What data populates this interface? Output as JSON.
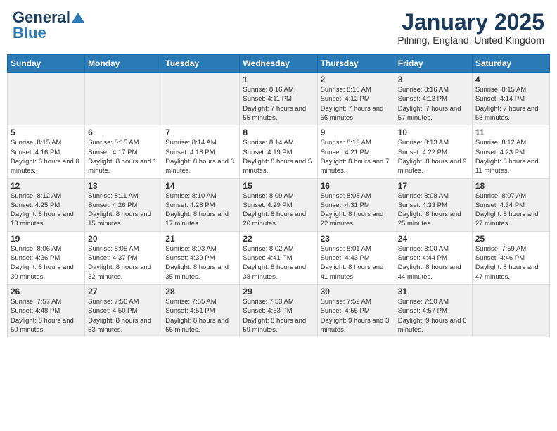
{
  "header": {
    "logo_line1": "General",
    "logo_line2": "Blue",
    "month": "January 2025",
    "location": "Pilning, England, United Kingdom"
  },
  "weekdays": [
    "Sunday",
    "Monday",
    "Tuesday",
    "Wednesday",
    "Thursday",
    "Friday",
    "Saturday"
  ],
  "weeks": [
    [
      {
        "day": "",
        "info": ""
      },
      {
        "day": "",
        "info": ""
      },
      {
        "day": "",
        "info": ""
      },
      {
        "day": "1",
        "info": "Sunrise: 8:16 AM\nSunset: 4:11 PM\nDaylight: 7 hours and 55 minutes."
      },
      {
        "day": "2",
        "info": "Sunrise: 8:16 AM\nSunset: 4:12 PM\nDaylight: 7 hours and 56 minutes."
      },
      {
        "day": "3",
        "info": "Sunrise: 8:16 AM\nSunset: 4:13 PM\nDaylight: 7 hours and 57 minutes."
      },
      {
        "day": "4",
        "info": "Sunrise: 8:15 AM\nSunset: 4:14 PM\nDaylight: 7 hours and 58 minutes."
      }
    ],
    [
      {
        "day": "5",
        "info": "Sunrise: 8:15 AM\nSunset: 4:16 PM\nDaylight: 8 hours and 0 minutes."
      },
      {
        "day": "6",
        "info": "Sunrise: 8:15 AM\nSunset: 4:17 PM\nDaylight: 8 hours and 1 minute."
      },
      {
        "day": "7",
        "info": "Sunrise: 8:14 AM\nSunset: 4:18 PM\nDaylight: 8 hours and 3 minutes."
      },
      {
        "day": "8",
        "info": "Sunrise: 8:14 AM\nSunset: 4:19 PM\nDaylight: 8 hours and 5 minutes."
      },
      {
        "day": "9",
        "info": "Sunrise: 8:13 AM\nSunset: 4:21 PM\nDaylight: 8 hours and 7 minutes."
      },
      {
        "day": "10",
        "info": "Sunrise: 8:13 AM\nSunset: 4:22 PM\nDaylight: 8 hours and 9 minutes."
      },
      {
        "day": "11",
        "info": "Sunrise: 8:12 AM\nSunset: 4:23 PM\nDaylight: 8 hours and 11 minutes."
      }
    ],
    [
      {
        "day": "12",
        "info": "Sunrise: 8:12 AM\nSunset: 4:25 PM\nDaylight: 8 hours and 13 minutes."
      },
      {
        "day": "13",
        "info": "Sunrise: 8:11 AM\nSunset: 4:26 PM\nDaylight: 8 hours and 15 minutes."
      },
      {
        "day": "14",
        "info": "Sunrise: 8:10 AM\nSunset: 4:28 PM\nDaylight: 8 hours and 17 minutes."
      },
      {
        "day": "15",
        "info": "Sunrise: 8:09 AM\nSunset: 4:29 PM\nDaylight: 8 hours and 20 minutes."
      },
      {
        "day": "16",
        "info": "Sunrise: 8:08 AM\nSunset: 4:31 PM\nDaylight: 8 hours and 22 minutes."
      },
      {
        "day": "17",
        "info": "Sunrise: 8:08 AM\nSunset: 4:33 PM\nDaylight: 8 hours and 25 minutes."
      },
      {
        "day": "18",
        "info": "Sunrise: 8:07 AM\nSunset: 4:34 PM\nDaylight: 8 hours and 27 minutes."
      }
    ],
    [
      {
        "day": "19",
        "info": "Sunrise: 8:06 AM\nSunset: 4:36 PM\nDaylight: 8 hours and 30 minutes."
      },
      {
        "day": "20",
        "info": "Sunrise: 8:05 AM\nSunset: 4:37 PM\nDaylight: 8 hours and 32 minutes."
      },
      {
        "day": "21",
        "info": "Sunrise: 8:03 AM\nSunset: 4:39 PM\nDaylight: 8 hours and 35 minutes."
      },
      {
        "day": "22",
        "info": "Sunrise: 8:02 AM\nSunset: 4:41 PM\nDaylight: 8 hours and 38 minutes."
      },
      {
        "day": "23",
        "info": "Sunrise: 8:01 AM\nSunset: 4:43 PM\nDaylight: 8 hours and 41 minutes."
      },
      {
        "day": "24",
        "info": "Sunrise: 8:00 AM\nSunset: 4:44 PM\nDaylight: 8 hours and 44 minutes."
      },
      {
        "day": "25",
        "info": "Sunrise: 7:59 AM\nSunset: 4:46 PM\nDaylight: 8 hours and 47 minutes."
      }
    ],
    [
      {
        "day": "26",
        "info": "Sunrise: 7:57 AM\nSunset: 4:48 PM\nDaylight: 8 hours and 50 minutes."
      },
      {
        "day": "27",
        "info": "Sunrise: 7:56 AM\nSunset: 4:50 PM\nDaylight: 8 hours and 53 minutes."
      },
      {
        "day": "28",
        "info": "Sunrise: 7:55 AM\nSunset: 4:51 PM\nDaylight: 8 hours and 56 minutes."
      },
      {
        "day": "29",
        "info": "Sunrise: 7:53 AM\nSunset: 4:53 PM\nDaylight: 8 hours and 59 minutes."
      },
      {
        "day": "30",
        "info": "Sunrise: 7:52 AM\nSunset: 4:55 PM\nDaylight: 9 hours and 3 minutes."
      },
      {
        "day": "31",
        "info": "Sunrise: 7:50 AM\nSunset: 4:57 PM\nDaylight: 9 hours and 6 minutes."
      },
      {
        "day": "",
        "info": ""
      }
    ]
  ]
}
